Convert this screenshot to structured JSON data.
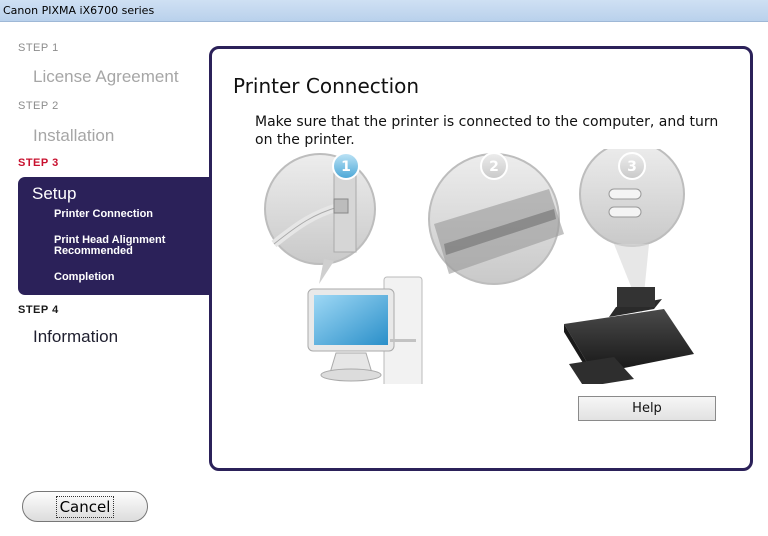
{
  "window": {
    "title": "Canon PIXMA iX6700 series"
  },
  "steps": [
    {
      "label": "STEP 1",
      "title": "License Agreement"
    },
    {
      "label": "STEP 2",
      "title": "Installation"
    },
    {
      "label": "STEP 3",
      "title": "Setup",
      "subitems": [
        "Printer Connection",
        "Print Head Alignment Recommended",
        "Completion"
      ]
    },
    {
      "label": "STEP 4",
      "title": "Information"
    }
  ],
  "main": {
    "title": "Printer Connection",
    "instruction": "Make sure that the printer is connected to the computer, and turn on the printer.",
    "callouts": [
      "1",
      "2",
      "3"
    ],
    "help_label": "Help"
  },
  "footer": {
    "cancel_label": "Cancel"
  },
  "colors": {
    "active_panel": "#2b2159",
    "active_step_label": "#c8102e",
    "callout_blue": "#6fb7dc"
  }
}
